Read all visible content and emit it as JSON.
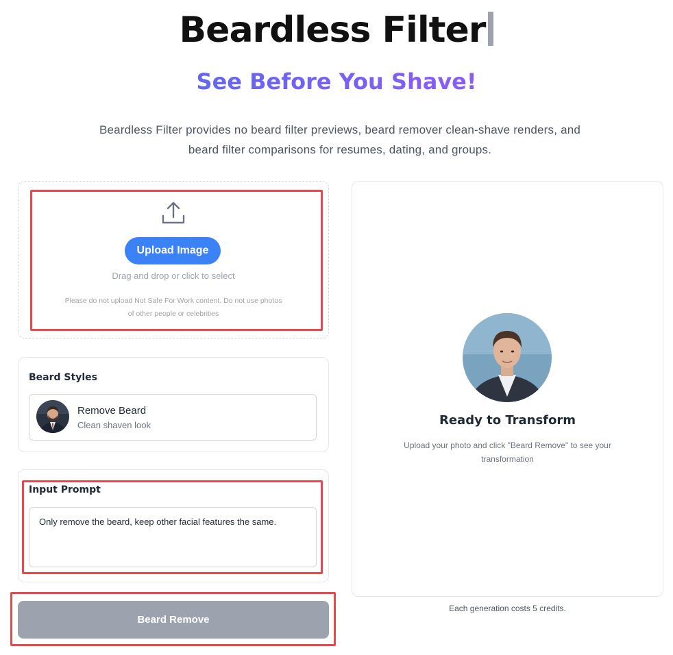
{
  "header": {
    "title": "Beardless Filter",
    "subtitle": "See Before You Shave!",
    "description": "Beardless Filter provides no beard filter previews, beard remover clean-shave renders, and beard filter comparisons for resumes, dating, and groups."
  },
  "upload": {
    "icon": "upload-icon",
    "button_label": "Upload Image",
    "hint": "Drag and drop or click to select",
    "warning": "Please do not upload Not Safe For Work content. Do not use photos of other people or celebrities"
  },
  "beard_styles": {
    "label": "Beard Styles",
    "options": [
      {
        "title": "Remove Beard",
        "subtitle": "Clean shaven look"
      }
    ]
  },
  "prompt": {
    "label": "Input Prompt",
    "value": "Only remove the beard, keep other facial features the same."
  },
  "action": {
    "button_label": "Beard Remove"
  },
  "result": {
    "title": "Ready to Transform",
    "description": "Upload your photo and click \"Beard Remove\" to see your transformation",
    "cost_note": "Each generation costs 5 credits."
  },
  "colors": {
    "primary_blue": "#3b82f6",
    "subtitle_gradient_start": "#6366f1",
    "subtitle_gradient_end": "#8b5cf6",
    "disabled_button": "#9ca3af",
    "highlight_red": "#e5484d"
  }
}
